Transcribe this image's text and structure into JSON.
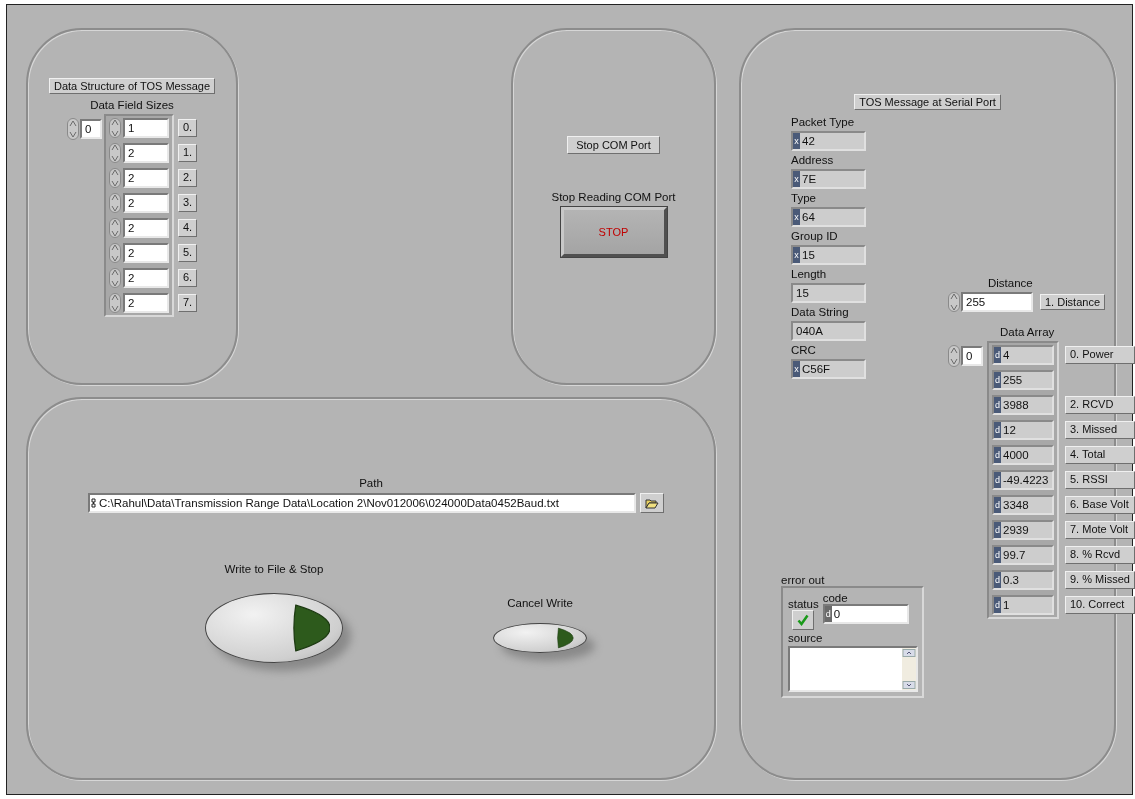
{
  "data_structure": {
    "title": "Data Structure of TOS Message",
    "array_label": "Data Field Sizes",
    "index": "0",
    "elements": [
      {
        "value": "1",
        "label": "0."
      },
      {
        "value": "2",
        "label": "1."
      },
      {
        "value": "2",
        "label": "2."
      },
      {
        "value": "2",
        "label": "3."
      },
      {
        "value": "2",
        "label": "4."
      },
      {
        "value": "2",
        "label": "5."
      },
      {
        "value": "2",
        "label": "6."
      },
      {
        "value": "2",
        "label": "7."
      }
    ]
  },
  "stop_panel": {
    "stop_com_port": "Stop COM Port",
    "stop_label": "Stop Reading COM Port",
    "stop_text": "STOP"
  },
  "file_panel": {
    "path_label": "Path",
    "path": "C:\\Rahul\\Data\\Transmission Range Data\\Location 2\\Nov012006\\024000Data0452Baud.txt",
    "write_label": "Write to File & Stop",
    "cancel_label": "Cancel Write"
  },
  "serial_panel": {
    "title": "TOS Message at Serial Port",
    "fields": [
      {
        "label": "Packet Type",
        "value": "42",
        "radix": "x"
      },
      {
        "label": "Address",
        "value": "7E",
        "radix": "x"
      },
      {
        "label": "Type",
        "value": "64",
        "radix": "x"
      },
      {
        "label": "Group ID",
        "value": "15",
        "radix": "x"
      },
      {
        "label": "Length",
        "value": "15"
      },
      {
        "label": "Data String",
        "value": "040A"
      },
      {
        "label": "CRC",
        "value": "C56F",
        "radix": "x"
      }
    ],
    "distance": {
      "label": "Distance",
      "value": "255",
      "name": "1. Distance"
    },
    "data_array": {
      "label": "Data Array",
      "index": "0",
      "elements": [
        {
          "value": "4",
          "radix": "d",
          "label": "0. Power"
        },
        {
          "value": "255",
          "radix": "d"
        },
        {
          "value": "3988",
          "radix": "d",
          "label": "2. RCVD"
        },
        {
          "value": "12",
          "radix": "d",
          "label": "3. Missed"
        },
        {
          "value": "4000",
          "radix": "d",
          "label": "4. Total"
        },
        {
          "value": "-49.4223",
          "radix": "d",
          "label": "5. RSSI"
        },
        {
          "value": "3348",
          "radix": "d",
          "label": "6. Base Volt"
        },
        {
          "value": "2939",
          "radix": "d",
          "label": "7. Mote Volt"
        },
        {
          "value": "99.7",
          "radix": "d",
          "label": "8. % Rcvd"
        },
        {
          "value": "0.3",
          "radix": "d",
          "label": "9. % Missed"
        },
        {
          "value": "1",
          "radix": "d",
          "label": "10. Correct"
        }
      ]
    },
    "error_out": {
      "label": "error out",
      "status_label": "status",
      "error": false,
      "code_label": "code",
      "code": "0",
      "code_radix": "d",
      "source_label": "source"
    }
  }
}
